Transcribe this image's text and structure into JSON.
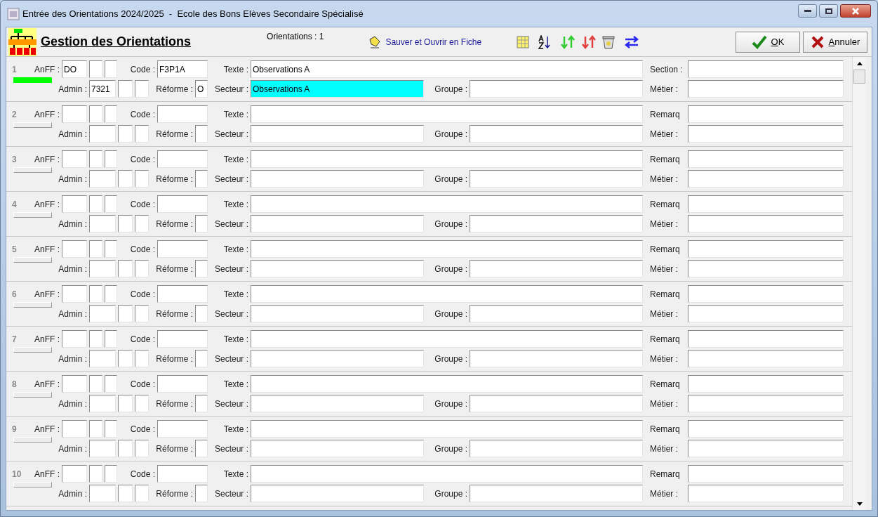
{
  "window": {
    "title": "Entrée des Orientations 2024/2025  -  Ecole des Bons Elèves Secondaire Spécialisé"
  },
  "header": {
    "title": "Gestion des Orientations",
    "count": "Orientations : 1",
    "save_link": "Sauver et Ouvrir en Fiche"
  },
  "buttons": [
    {
      "kind": "ok",
      "label": "OK"
    },
    {
      "kind": "cancel",
      "label": "Annuler"
    }
  ],
  "rows": [
    {
      "number": "1",
      "selected": true,
      "anff_label": "AnFF :",
      "anff": "DO",
      "code_label": "Code :",
      "code": "F3P1A",
      "texte_label": "Texte :",
      "texte": "Observations A",
      "side_label": "Section :",
      "admin_label": "Admin :",
      "admin": "7321",
      "reforme_label": "Réforme :",
      "reforme": "O",
      "secteur_label": "Secteur :",
      "secteur": "Observations A",
      "secteur_focused": true,
      "groupe_label": "Groupe :",
      "metier_label": "Métier :"
    },
    {
      "number": "2",
      "selected": false,
      "anff_label": "AnFF :",
      "code_label": "Code :",
      "texte_label": "Texte :",
      "side_label": "Remarq",
      "admin_label": "Admin :",
      "reforme_label": "Réforme :",
      "secteur_label": "Secteur :",
      "secteur_focused": false,
      "groupe_label": "Groupe :",
      "metier_label": "Métier :"
    },
    {
      "number": "3",
      "selected": false,
      "anff_label": "AnFF :",
      "code_label": "Code :",
      "texte_label": "Texte :",
      "side_label": "Remarq",
      "admin_label": "Admin :",
      "reforme_label": "Réforme :",
      "secteur_label": "Secteur :",
      "secteur_focused": false,
      "groupe_label": "Groupe :",
      "metier_label": "Métier :"
    },
    {
      "number": "4",
      "selected": false,
      "anff_label": "AnFF :",
      "code_label": "Code :",
      "texte_label": "Texte :",
      "side_label": "Remarq",
      "admin_label": "Admin :",
      "reforme_label": "Réforme :",
      "secteur_label": "Secteur :",
      "secteur_focused": false,
      "groupe_label": "Groupe :",
      "metier_label": "Métier :"
    },
    {
      "number": "5",
      "selected": false,
      "anff_label": "AnFF :",
      "code_label": "Code :",
      "texte_label": "Texte :",
      "side_label": "Remarq",
      "admin_label": "Admin :",
      "reforme_label": "Réforme :",
      "secteur_label": "Secteur :",
      "secteur_focused": false,
      "groupe_label": "Groupe :",
      "metier_label": "Métier :"
    },
    {
      "number": "6",
      "selected": false,
      "anff_label": "AnFF :",
      "code_label": "Code :",
      "texte_label": "Texte :",
      "side_label": "Remarq",
      "admin_label": "Admin :",
      "reforme_label": "Réforme :",
      "secteur_label": "Secteur :",
      "secteur_focused": false,
      "groupe_label": "Groupe :",
      "metier_label": "Métier :"
    },
    {
      "number": "7",
      "selected": false,
      "anff_label": "AnFF :",
      "code_label": "Code :",
      "texte_label": "Texte :",
      "side_label": "Remarq",
      "admin_label": "Admin :",
      "reforme_label": "Réforme :",
      "secteur_label": "Secteur :",
      "secteur_focused": false,
      "groupe_label": "Groupe :",
      "metier_label": "Métier :"
    },
    {
      "number": "8",
      "selected": false,
      "anff_label": "AnFF :",
      "code_label": "Code :",
      "texte_label": "Texte :",
      "side_label": "Remarq",
      "admin_label": "Admin :",
      "reforme_label": "Réforme :",
      "secteur_label": "Secteur :",
      "secteur_focused": false,
      "groupe_label": "Groupe :",
      "metier_label": "Métier :"
    },
    {
      "number": "9",
      "selected": false,
      "anff_label": "AnFF :",
      "code_label": "Code :",
      "texte_label": "Texte :",
      "side_label": "Remarq",
      "admin_label": "Admin :",
      "reforme_label": "Réforme :",
      "secteur_label": "Secteur :",
      "secteur_focused": false,
      "groupe_label": "Groupe :",
      "metier_label": "Métier :"
    },
    {
      "number": "10",
      "selected": false,
      "anff_label": "AnFF :",
      "code_label": "Code :",
      "texte_label": "Texte :",
      "side_label": "Remarq",
      "admin_label": "Admin :",
      "reforme_label": "Réforme :",
      "secteur_label": "Secteur :",
      "secteur_focused": false,
      "groupe_label": "Groupe :",
      "metier_label": "Métier :"
    }
  ]
}
